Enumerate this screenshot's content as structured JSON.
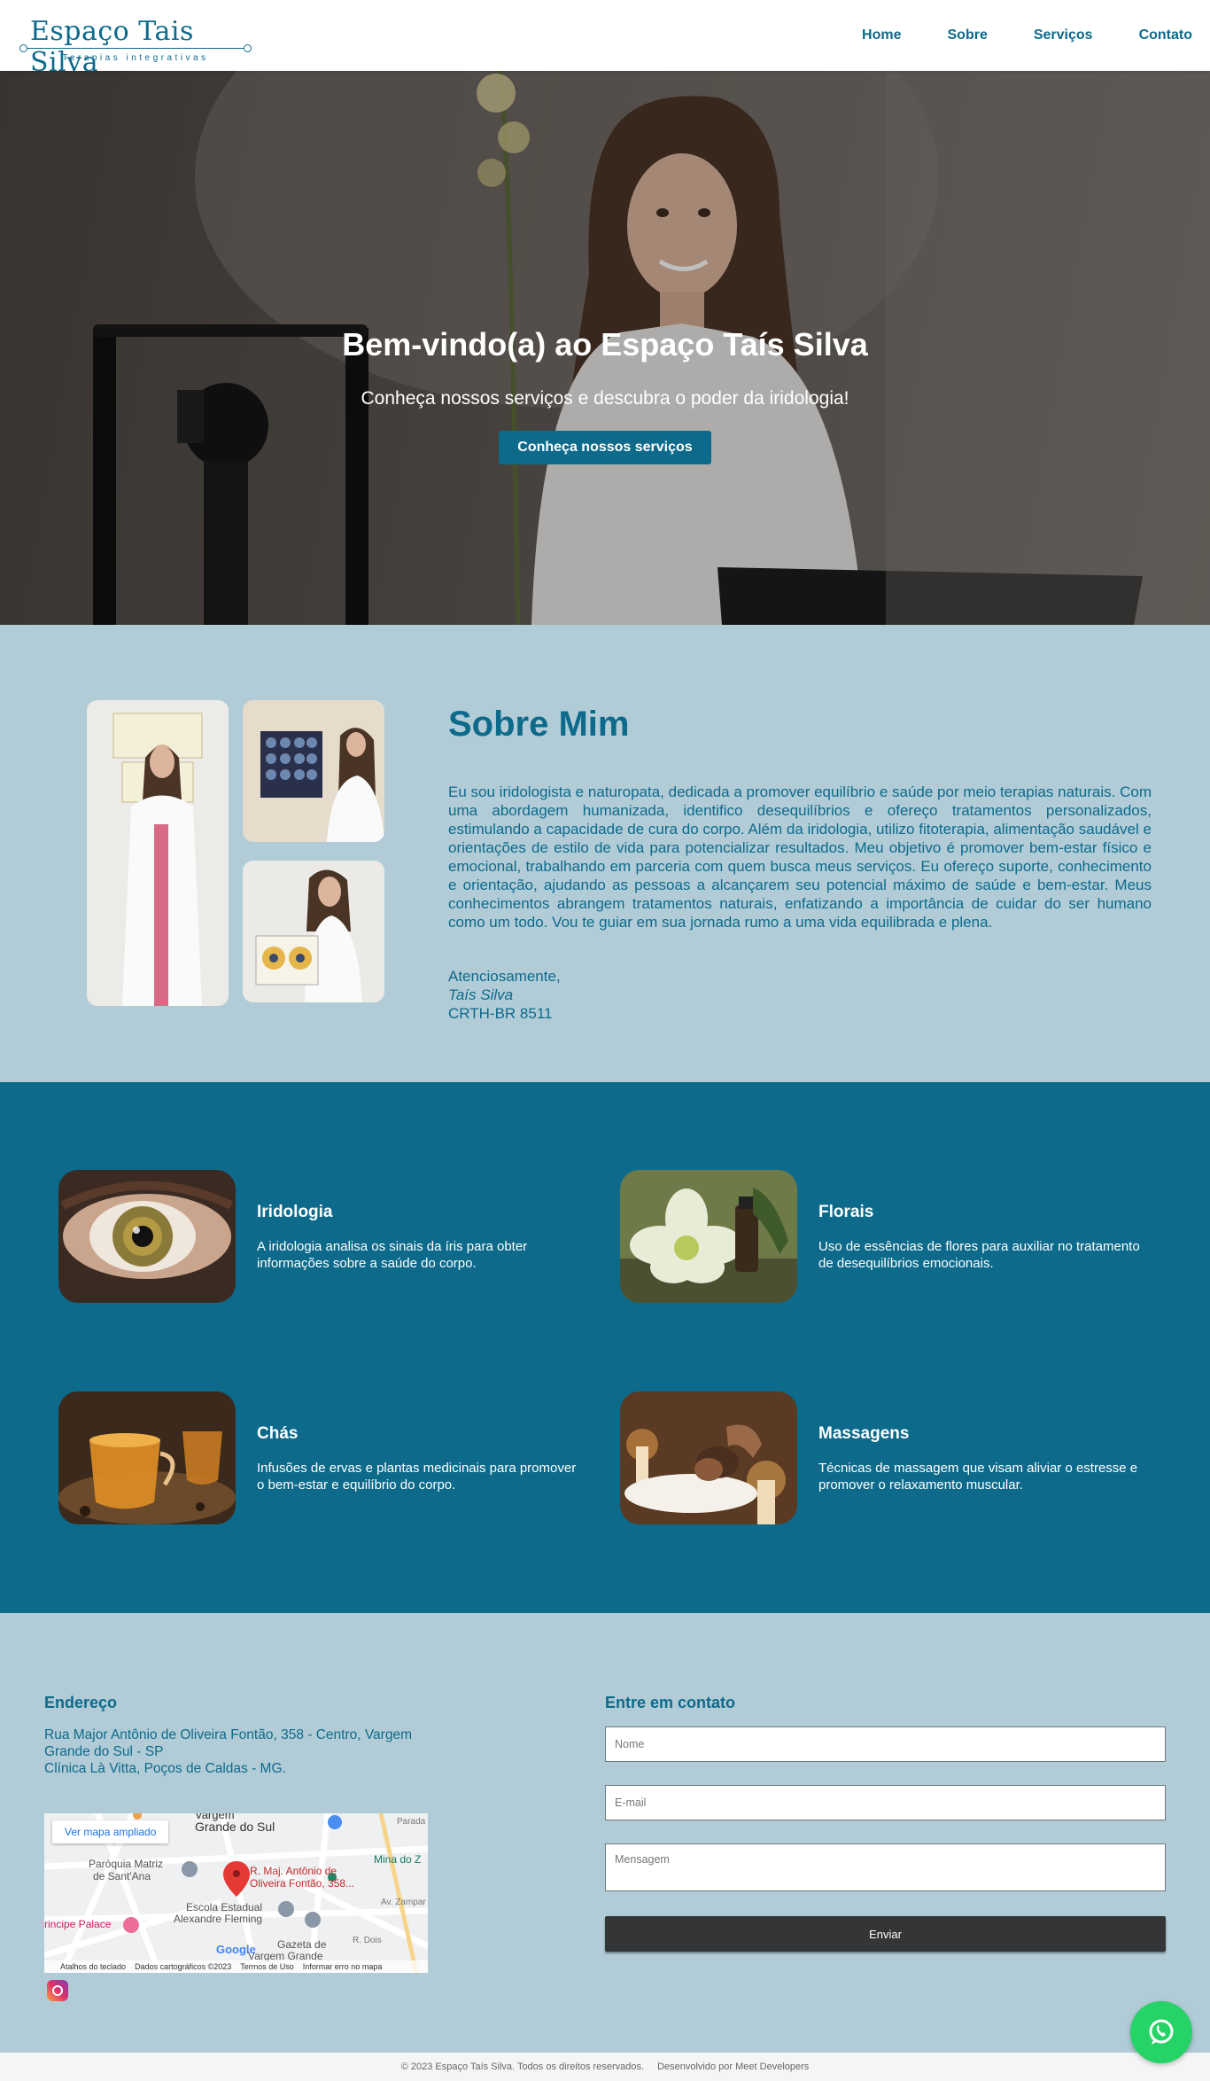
{
  "nav": {
    "logo_title": "Espaço Tais Silva",
    "logo_subtitle": "Terapias integrativas",
    "links": [
      "Home",
      "Sobre",
      "Serviços",
      "Contato"
    ]
  },
  "hero": {
    "title": "Bem-vindo(a) ao Espaço Taís Silva",
    "subtitle": "Conheça nossos serviços e descubra o poder da iridologia!",
    "button": "Conheça nossos serviços"
  },
  "about": {
    "title": "Sobre Mim",
    "body": "Eu sou iridologista e naturopata, dedicada a promover equilíbrio e saúde por meio terapias naturais. Com uma abordagem humanizada, identifico desequilíbrios e ofereço tratamentos personalizados, estimulando a capacidade de cura do corpo. Além da iridologia, utilizo fitoterapia, alimentação saudável e orientações de estilo de vida para potencializar resultados. Meu objetivo é promover bem-estar físico e emocional, trabalhando em parceria com quem busca meus serviços. Eu ofereço suporte, conhecimento e orientação, ajudando as pessoas a alcançarem seu potencial máximo de saúde e bem-estar. Meus conhecimentos abrangem tratamentos naturais, enfatizando a importância de cuidar do ser humano como um todo. Vou te guiar em sua jornada rumo a uma vida equilibrada e plena.",
    "closing": "Atenciosamente,",
    "name": "Taís Silva",
    "registration": "CRTH-BR 8511"
  },
  "services": [
    {
      "title": "Iridologia",
      "description": "A iridologia analisa os sinais da íris para obter informações sobre a saúde do corpo."
    },
    {
      "title": "Florais",
      "description": "Uso de essências de flores para auxiliar no tratamento de desequilíbrios emocionais."
    },
    {
      "title": "Chás",
      "description": "Infusões de ervas e plantas medicinais para promover o bem-estar e equilíbrio do corpo."
    },
    {
      "title": "Massagens",
      "description": "Técnicas de massagem que visam aliviar o estresse e promover o relaxamento muscular."
    }
  ],
  "contact": {
    "address_title": "Endereço",
    "address_line1": "Rua Major Antônio de Oliveira Fontão, 358 - Centro, Vargem Grande do Sul - SP",
    "address_line2": "Clínica Là Vitta, Poços de Caldas - MG.",
    "map": {
      "link": "Ver mapa ampliado",
      "pin_label_1": "R. Maj. Antônio de",
      "pin_label_2": "Oliveira Fontão, 358...",
      "places": [
        "Vargem",
        "Grande do Sul",
        "Paróquia Matriz",
        "de Sant'Ana",
        "Escola Estadual",
        "Alexandre Fleming",
        "rincipe Palace",
        "Mina do Z",
        "Gazeta de",
        "Vargem Grande",
        "Parada",
        "Av. Zampar",
        "R. Dois"
      ],
      "footer": [
        "Atalhos do teclado",
        "Dados cartográficos ©2023",
        "Termos de Uso",
        "Informar erro no mapa"
      ],
      "google": "Google"
    },
    "form_title": "Entre em contato",
    "name_placeholder": "Nome",
    "email_placeholder": "E-mail",
    "message_placeholder": "Mensagem",
    "submit": "Enviar"
  },
  "footer": {
    "copyright": "© 2023 Espaço Taís Silva. Todos os direitos reservados.",
    "developer": "Desenvolvido por Meet Developers"
  },
  "colors": {
    "brand": "#0d6a8b",
    "section_bg": "#b1ccd7",
    "whatsapp": "#25d366"
  }
}
